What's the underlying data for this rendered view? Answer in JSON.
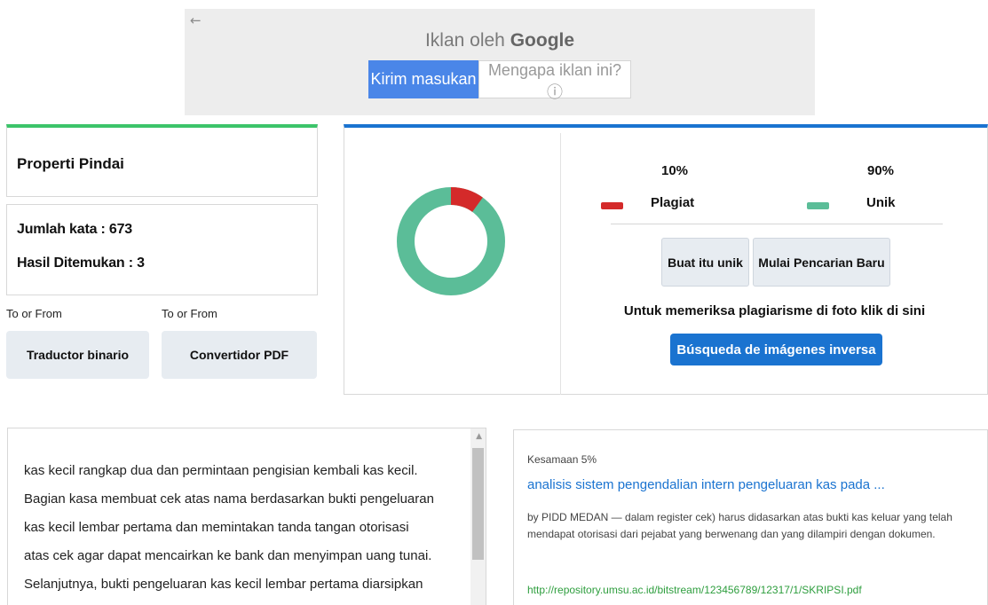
{
  "ad": {
    "back_icon": "arrow-left-icon",
    "title_prefix": "Iklan oleh",
    "title_brand": "Google",
    "send_feedback_label": "Kirim masukan",
    "why_label": "Mengapa iklan ini? ⓘ"
  },
  "scan": {
    "title": "Properti Pindai",
    "word_count": "Jumlah kata : 673",
    "results_found": "Hasil Ditemukan : 3"
  },
  "tools": [
    {
      "caption": "To or From",
      "label": "Traductor binario"
    },
    {
      "caption": "To or From",
      "label": "Convertidor PDF"
    }
  ],
  "result": {
    "plagiarism_pct": "10%",
    "plagiarism_label": "Plagiat",
    "unique_pct": "90%",
    "unique_label": "Unik",
    "make_unique_label": "Buat itu unik",
    "new_search_label": "Mulai Pencarian Baru",
    "photo_text": "Untuk memeriksa plagiarisme di foto klik di sini",
    "reverse_search_label": "Búsqueda de imágenes inversa",
    "colors": {
      "plagiarism": "#d42a2a",
      "unique": "#5bbd98",
      "accent": "#1a73d0"
    },
    "plagiarism_fraction": 0.1
  },
  "text": {
    "lines": [
      "kas kecil rangkap dua dan permintaan pengisian kembali kas kecil.",
      "Bagian kasa membuat cek atas nama berdasarkan bukti pengeluaran",
      "kas kecil lembar pertama dan memintakan tanda tangan otorisasi",
      "atas cek agar dapat mencairkan ke bank dan menyimpan uang tunai.",
      "Selanjutnya, bukti pengeluaran kas kecil lembar pertama diarsipkan"
    ]
  },
  "match": {
    "similarity": "Kesamaan 5%",
    "title": "analisis sistem pengendalian intern pengeluaran kas pada ...",
    "description": "by PIDD MEDAN — dalam register cek) harus didasarkan atas bukti kas keluar yang telah mendapat otorisasi dari pejabat yang berwenang dan yang dilampiri dengan dokumen.",
    "url": "http://repository.umsu.ac.id/bitstream/123456789/12317/1/SKRIPSI.pdf"
  }
}
